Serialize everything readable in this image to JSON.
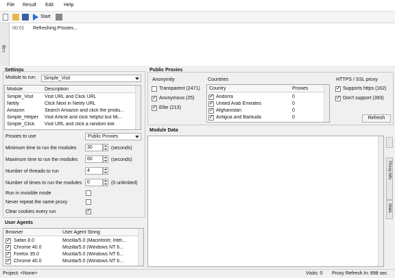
{
  "menu": [
    "File",
    "Result",
    "Edit",
    "Help"
  ],
  "toolbar": {
    "start_label": "Start"
  },
  "log": {
    "side_label": "Log",
    "time": "00:01",
    "message": "Refreshing Proxies..."
  },
  "settings": {
    "title": "Settings",
    "module_label": "Module to run:",
    "module_value": "Simple_Visit",
    "table_headers": [
      "Module",
      "Description"
    ],
    "modules": [
      [
        "Simple_Visit",
        "Visit URL and Click URL"
      ],
      [
        "Netify",
        "Click Next in Netify URL"
      ],
      [
        "Amazon",
        "Search Amazon and click the produ..."
      ],
      [
        "Simple_Helper",
        "Visit Article and click helpful but Mi..."
      ],
      [
        "Simple_Click",
        "Visit URL and click a random link"
      ]
    ],
    "proxies_label": "Proxies to use",
    "proxies_value": "Public Proxies",
    "min_time_label": "Minimum time to run the modules",
    "min_time_value": "30",
    "min_time_unit": "(seconds)",
    "max_time_label": "Maximum time to run the modules",
    "max_time_value": "60",
    "max_time_unit": "(seconds)",
    "threads_label": "Number of threads to run",
    "threads_value": "4",
    "times_label": "Number of times to run the modules",
    "times_value": "0",
    "times_unit": "(0 unlimited)",
    "invisible_label": "Run in invisible mode",
    "never_repeat_label": "Never repeat the same proxy",
    "clear_cookies_label": "Clear cookies every run"
  },
  "user_agents": {
    "title": "User Agents",
    "headers": [
      "Browser",
      "User Agent String"
    ],
    "rows": [
      [
        "Safari 8.0",
        "Mozilla/5.0 (Macintosh; Intel..."
      ],
      [
        "Chrome 40.0",
        "Mozilla/5.0 (Windows NT 6..."
      ],
      [
        "Firefox 35.0",
        "Mozilla/5.0 (Windows NT 6..."
      ],
      [
        "Chrome 40.0",
        "Mozilla/5.0 (Windows NT 6..."
      ]
    ]
  },
  "public_proxies": {
    "title": "Public Proxies",
    "anonymity_title": "Anonymity",
    "anonymity": [
      {
        "label": "Transparent (2471)",
        "checked": false
      },
      {
        "label": "Anonymous (25)",
        "checked": true
      },
      {
        "label": "Elite (213)",
        "checked": true
      }
    ],
    "countries_title": "Countries",
    "country_headers": [
      "Country",
      "Proxies"
    ],
    "countries": [
      [
        "Andorra",
        "0"
      ],
      [
        "United Arab Emirates",
        "0"
      ],
      [
        "Afghanistan",
        "0"
      ],
      [
        "Antigua and Barbuda",
        "0"
      ]
    ],
    "https_title": "HTTPS / SSL proxy",
    "https_options": [
      {
        "label": "Supports https (162)",
        "checked": true
      },
      {
        "label": "Don't support (393)",
        "checked": true
      }
    ],
    "refresh_label": "Refresh"
  },
  "module_data": {
    "title": "Module Data"
  },
  "side_tabs": [
    "Proxy Info",
    "Stats"
  ],
  "status": {
    "project": "Project: <None>",
    "visits": "Visits: 0",
    "proxy_refresh": "Proxy Refresh In: 898 sec"
  },
  "colors": {
    "play": "#2a6fd6",
    "stop": "#888888",
    "folder": "#e8b84a",
    "save": "#3a5fa0"
  }
}
